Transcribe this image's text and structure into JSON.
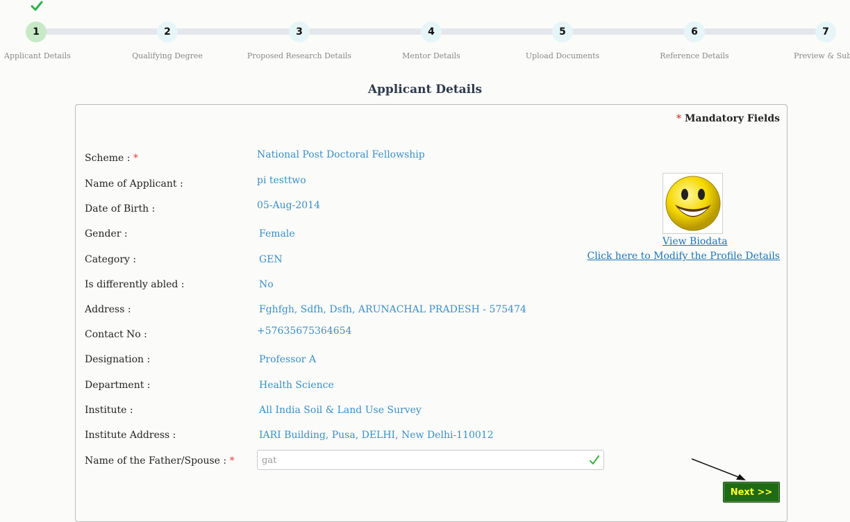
{
  "stepper": {
    "steps": [
      {
        "number": "1",
        "label": "Applicant Details",
        "state": "done"
      },
      {
        "number": "2",
        "label": "Qualifying Degree"
      },
      {
        "number": "3",
        "label": "Proposed Research Details"
      },
      {
        "number": "4",
        "label": "Mentor Details"
      },
      {
        "number": "5",
        "label": "Upload Documents"
      },
      {
        "number": "6",
        "label": "Reference Details"
      },
      {
        "number": "7",
        "label": "Preview & Subm"
      }
    ]
  },
  "page": {
    "title": "Applicant Details",
    "mandatory_star": "*",
    "mandatory_label": "Mandatory Fields"
  },
  "fields": [
    {
      "label": "Scheme :",
      "required": "*",
      "value": "National Post Doctoral Fellowship"
    },
    {
      "label": "Name of Applicant :",
      "value": "pi testtwo"
    },
    {
      "label": "Date of Birth :",
      "value": "05-Aug-2014"
    },
    {
      "label": "Gender :",
      "value": "Female"
    },
    {
      "label": "Category :",
      "value": "GEN"
    },
    {
      "label": "Is differently abled :",
      "value": "No"
    },
    {
      "label": "Address :",
      "value": "Fghfgh, Sdfh, Dsfh, ARUNACHAL PRADESH - 575474"
    },
    {
      "label": "Contact No :",
      "value": "+57635675364654"
    },
    {
      "label": "Designation :",
      "value": "Professor A"
    },
    {
      "label": "Department :",
      "value": "Health Science"
    },
    {
      "label": "Institute :",
      "value": "All India Soil & Land Use Survey"
    },
    {
      "label": "Institute Address :",
      "value": "IARI Building, Pusa, DELHI, New Delhi-110012"
    }
  ],
  "father_field": {
    "label": "Name of the Father/Spouse :",
    "required": "*",
    "value": "gat"
  },
  "profile": {
    "photo_icon": "smiley-face-icon",
    "view_biodata": "View Biodata",
    "modify_profile": "Click here to Modify the Profile Details"
  },
  "actions": {
    "next_label": "Next >>"
  },
  "colors": {
    "value_text": "#3a8fc8",
    "link": "#1a73b8",
    "next_bg": "#1f6a15",
    "next_text": "#ffff33",
    "step_done": "#c8e9c5",
    "step_pending": "#e6f5f7",
    "required_star": "#e23b3b"
  }
}
